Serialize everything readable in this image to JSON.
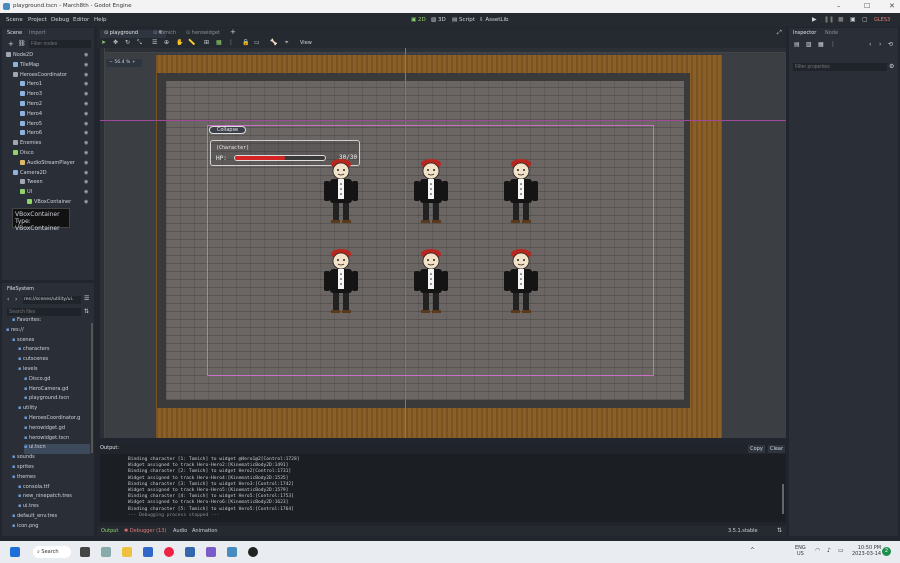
{
  "window": {
    "title": "playground.tscn - March8th - Godot Engine"
  },
  "menu": [
    "Scene",
    "Project",
    "Debug",
    "Editor",
    "Help"
  ],
  "workspaces": [
    {
      "label": "2D",
      "active": true
    },
    {
      "label": "3D",
      "active": false
    },
    {
      "label": "Script",
      "active": false
    },
    {
      "label": "AssetLib",
      "active": false
    }
  ],
  "renderer": "GLES3",
  "scene_dock": {
    "tabs": [
      "Scene",
      "Import"
    ],
    "filter_placeholder": "Filter nodes",
    "nodes": [
      {
        "label": "Node2D",
        "depth": 0,
        "color": "#9ea7b3"
      },
      {
        "label": "TileMap",
        "depth": 1,
        "color": "#8fb3e0"
      },
      {
        "label": "HeroesCoordinator",
        "depth": 1,
        "color": "#9ea7b3"
      },
      {
        "label": "Hero1",
        "depth": 2,
        "color": "#8fb3e0"
      },
      {
        "label": "Hero3",
        "depth": 2,
        "color": "#8fb3e0"
      },
      {
        "label": "Hero2",
        "depth": 2,
        "color": "#8fb3e0"
      },
      {
        "label": "Hero4",
        "depth": 2,
        "color": "#8fb3e0"
      },
      {
        "label": "Hero5",
        "depth": 2,
        "color": "#8fb3e0"
      },
      {
        "label": "Hero6",
        "depth": 2,
        "color": "#8fb3e0"
      },
      {
        "label": "Enemies",
        "depth": 1,
        "color": "#9ea7b3"
      },
      {
        "label": "Disco",
        "depth": 1,
        "color": "#8fd36b"
      },
      {
        "label": "AudioStreamPlayer",
        "depth": 2,
        "color": "#e0b86b"
      },
      {
        "label": "Camera2D",
        "depth": 1,
        "color": "#8fb3e0"
      },
      {
        "label": "Tween",
        "depth": 2,
        "color": "#9ea7b3"
      },
      {
        "label": "UI",
        "depth": 2,
        "color": "#8fd36b"
      },
      {
        "label": "VBoxContainer",
        "depth": 3,
        "color": "#8fd36b"
      }
    ],
    "tooltip_line1": "VBoxContainer",
    "tooltip_line2": "Type: VBoxContainer"
  },
  "filesystem": {
    "title": "FileSystem",
    "path": "res://scenes/utility/ui.",
    "search_placeholder": "Search files",
    "items": [
      {
        "label": "Favorites:",
        "depth": 1
      },
      {
        "label": "res://",
        "depth": 0
      },
      {
        "label": "scenes",
        "depth": 1
      },
      {
        "label": "characters",
        "depth": 2
      },
      {
        "label": "cutscenes",
        "depth": 2
      },
      {
        "label": "levels",
        "depth": 2
      },
      {
        "label": "Disco.gd",
        "depth": 3
      },
      {
        "label": "HeroCamera.gd",
        "depth": 3
      },
      {
        "label": "playground.tscn",
        "depth": 3
      },
      {
        "label": "utility",
        "depth": 2
      },
      {
        "label": "HeroesCoordinator.g",
        "depth": 3
      },
      {
        "label": "herowidget.gd",
        "depth": 3
      },
      {
        "label": "herowidget.tscn",
        "depth": 3
      },
      {
        "label": "ui.tscn",
        "depth": 3,
        "selected": true
      },
      {
        "label": "sounds",
        "depth": 1
      },
      {
        "label": "sprites",
        "depth": 1
      },
      {
        "label": "themes",
        "depth": 1
      },
      {
        "label": "consola.ttf",
        "depth": 2
      },
      {
        "label": "new_ninepatch.tres",
        "depth": 2
      },
      {
        "label": "ui.tres",
        "depth": 2
      },
      {
        "label": "default_env.tres",
        "depth": 1
      },
      {
        "label": "icon.png",
        "depth": 1
      }
    ]
  },
  "scene_tabs": [
    "playground",
    "Tomich",
    "herowidget"
  ],
  "toolbar": {
    "view_label": "View"
  },
  "viewport": {
    "zoom": "56.4 %",
    "collapse_label": "Collapse",
    "hero_name": "(Character)",
    "hp_label": "HP:",
    "hp_value": "30/30",
    "hp_fraction": 0.55
  },
  "output": {
    "title": "Output:",
    "copy_label": "Copy",
    "clear_label": "Clear",
    "lines": [
      "Binding character [1: Tomich] to widget @Hero1@2[Control:1728]",
      "Widget assigned to track Hero-Hero2:[KinematicBody2D:1491]",
      "Binding character [2: Tomich] to widget Hero2[Control:1731]",
      "Widget assigned to track Hero-Hero4:[KinematicBody2D:1535]",
      "Binding character [3: Tomich] to widget Hero3:[Control:1742]",
      "Widget assigned to track Hero-Hero5:[KinematicBody2D:1579]",
      "Binding character [4: Tomich] to widget Hero5:[Control:1753]",
      "Widget assigned to track Hero-Hero6:[KinematicBody2D:1623]",
      "Binding character [5: Tomich] to widget Hero5:[Control:1764]",
      "--- Debugging process stopped ---"
    ]
  },
  "bottom_tabs": [
    {
      "label": "Output",
      "active": true
    },
    {
      "label": "Debugger (13)",
      "active": false
    },
    {
      "label": "Audio",
      "active": false
    },
    {
      "label": "Animation",
      "active": false
    }
  ],
  "version": "3.5.1.stable",
  "inspector": {
    "tabs": [
      "Inspector",
      "Node"
    ],
    "filter_placeholder": "Filter properties"
  },
  "taskbar": {
    "search_label": "Search",
    "lang": "ENG",
    "region": "US",
    "time": "10:50 PM",
    "date": "2023-03-14",
    "badge": "2"
  }
}
